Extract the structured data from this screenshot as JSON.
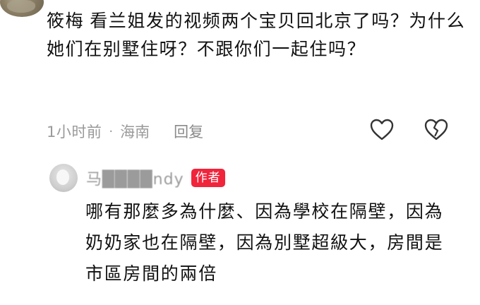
{
  "comment": {
    "username": "筱梅",
    "text": "看兰姐发的视频两个宝贝回北京了吗？为什么她们在别墅住呀？不跟你们一起住吗？",
    "time": "1小时前",
    "separator": "·",
    "location": "海南",
    "reply_label": "回复",
    "like_icon": "heart-outline-icon",
    "dislike_icon": "broken-heart-outline-icon"
  },
  "reply": {
    "username": "马████ndy",
    "badge": "作者",
    "badge_color": "#f0243b",
    "text": "哪有那麼多為什麼、因為學校在隔壁，因為奶奶家也在隔壁，因為別墅超級大，房間是市區房間的兩倍"
  },
  "colors": {
    "text": "#111111",
    "meta": "#9a9a9a",
    "background": "#ffffff"
  }
}
